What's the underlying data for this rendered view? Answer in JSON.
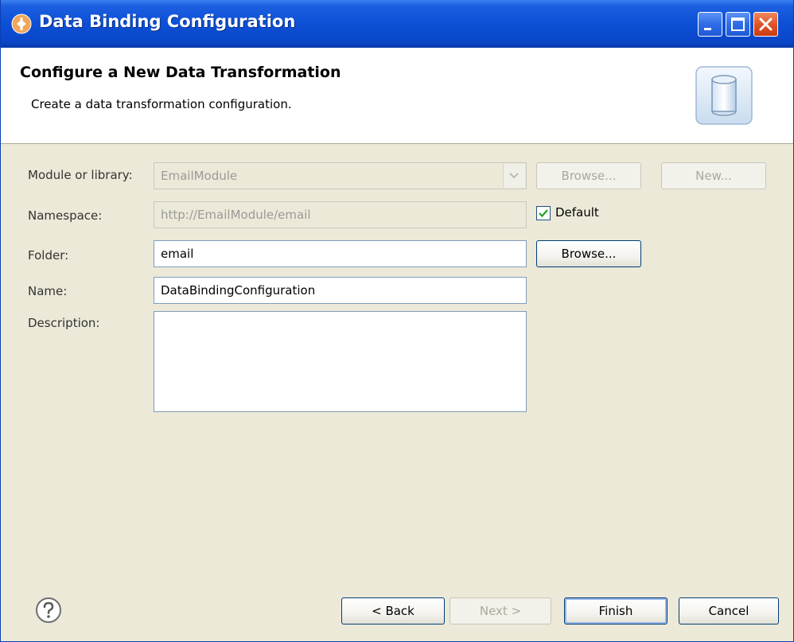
{
  "window": {
    "title": "Data Binding Configuration"
  },
  "header": {
    "title": "Configure a New Data Transformation",
    "description": "Create a data transformation configuration."
  },
  "form": {
    "module": {
      "label": "Module or library:",
      "value": "EmailModule",
      "browse_label": "Browse...",
      "new_label": "New..."
    },
    "namespace": {
      "label": "Namespace:",
      "value": "http://EmailModule/email",
      "default_label": "Default",
      "default_checked": true
    },
    "folder": {
      "label": "Folder:",
      "value": "email",
      "browse_label": "Browse..."
    },
    "name": {
      "label": "Name:",
      "value": "DataBindingConfiguration"
    },
    "description": {
      "label": "Description:",
      "value": ""
    }
  },
  "footer": {
    "back_label": "< Back",
    "next_label": "Next >",
    "finish_label": "Finish",
    "cancel_label": "Cancel"
  },
  "colors": {
    "titlebar": "#0c4fd6",
    "dialog_bg": "#ece9d8",
    "button_border": "#003c74"
  }
}
